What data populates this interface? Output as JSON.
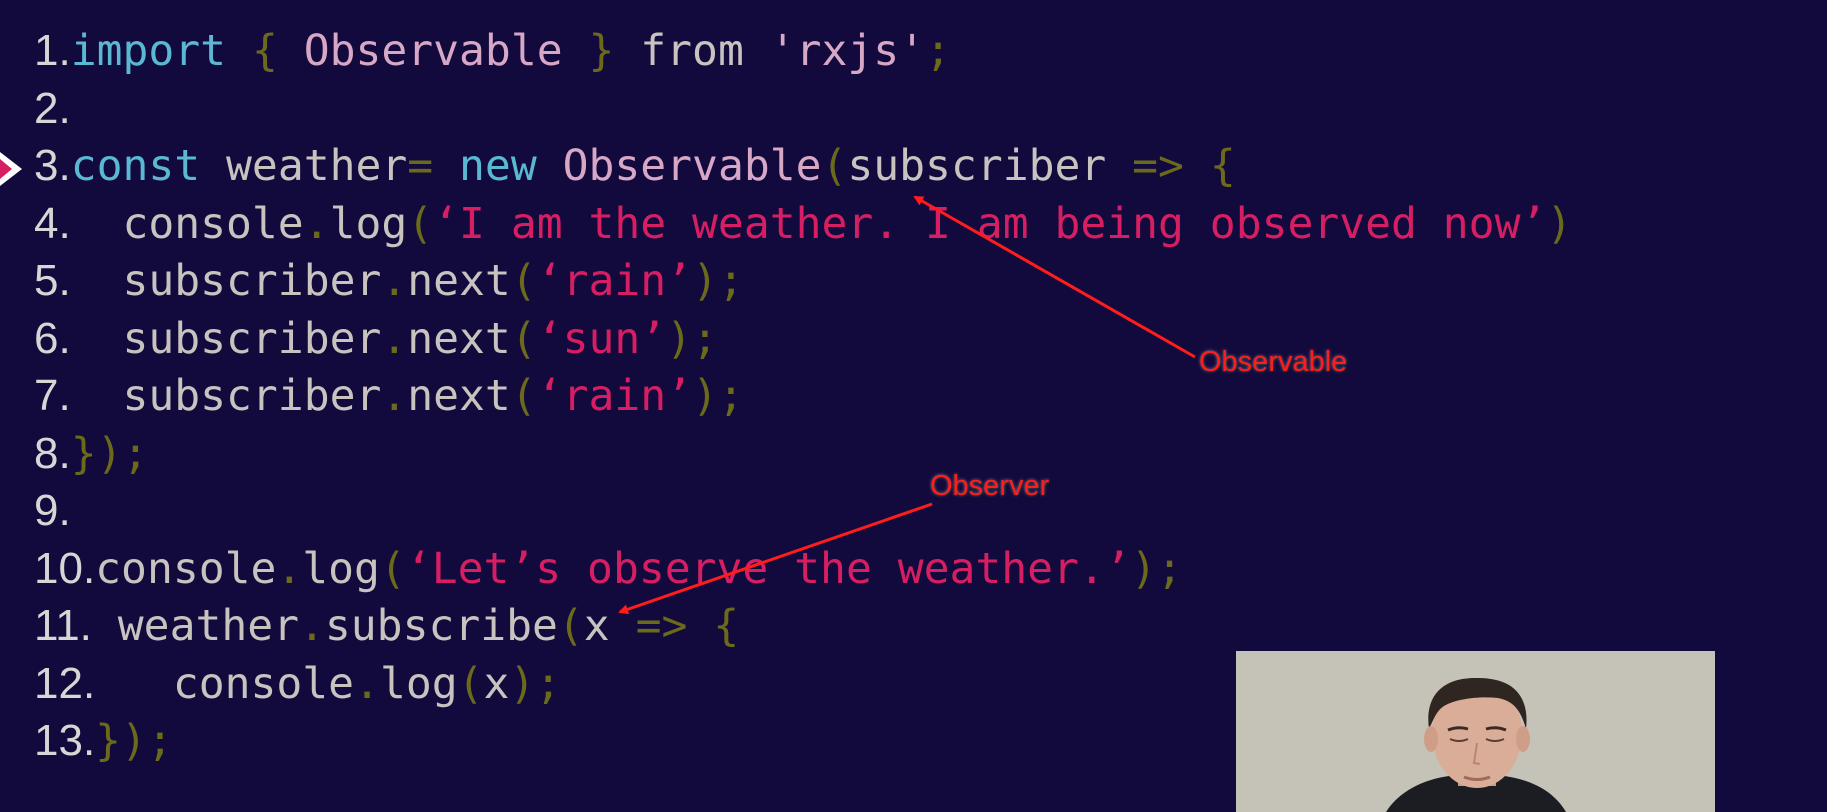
{
  "code_lines": [
    {
      "number": "1.",
      "tokens": [
        {
          "text": "import",
          "kind": "kw"
        },
        {
          "text": " ",
          "kind": "id"
        },
        {
          "text": "{",
          "kind": "pun"
        },
        {
          "text": " ",
          "kind": "id"
        },
        {
          "text": "Observable",
          "kind": "cls"
        },
        {
          "text": " ",
          "kind": "id"
        },
        {
          "text": "}",
          "kind": "pun"
        },
        {
          "text": " from ",
          "kind": "id"
        },
        {
          "text": "'rxjs'",
          "kind": "cls"
        },
        {
          "text": ";",
          "kind": "pun"
        }
      ]
    },
    {
      "number": "2.",
      "tokens": []
    },
    {
      "number": "3.",
      "tokens": [
        {
          "text": "const",
          "kind": "kw"
        },
        {
          "text": " weather",
          "kind": "id"
        },
        {
          "text": "=",
          "kind": "pun"
        },
        {
          "text": " ",
          "kind": "id"
        },
        {
          "text": "new",
          "kind": "kw"
        },
        {
          "text": " ",
          "kind": "id"
        },
        {
          "text": "Observable",
          "kind": "cls"
        },
        {
          "text": "(",
          "kind": "pun"
        },
        {
          "text": "subscriber ",
          "kind": "id"
        },
        {
          "text": "=>",
          "kind": "pun"
        },
        {
          "text": " ",
          "kind": "id"
        },
        {
          "text": "{",
          "kind": "pun"
        }
      ]
    },
    {
      "number": "4.",
      "tokens": [
        {
          "text": "  console",
          "kind": "id"
        },
        {
          "text": ".",
          "kind": "pun"
        },
        {
          "text": "log",
          "kind": "id"
        },
        {
          "text": "(",
          "kind": "pun"
        },
        {
          "text": "‘I am the weather. I am being observed now’",
          "kind": "str"
        },
        {
          "text": ")",
          "kind": "pun"
        }
      ]
    },
    {
      "number": "5.",
      "tokens": [
        {
          "text": "  subscriber",
          "kind": "id"
        },
        {
          "text": ".",
          "kind": "pun"
        },
        {
          "text": "next",
          "kind": "id"
        },
        {
          "text": "(",
          "kind": "pun"
        },
        {
          "text": "‘rain’",
          "kind": "str"
        },
        {
          "text": ");",
          "kind": "pun"
        }
      ]
    },
    {
      "number": "6.",
      "tokens": [
        {
          "text": "  subscriber",
          "kind": "id"
        },
        {
          "text": ".",
          "kind": "pun"
        },
        {
          "text": "next",
          "kind": "id"
        },
        {
          "text": "(",
          "kind": "pun"
        },
        {
          "text": "‘sun’",
          "kind": "str"
        },
        {
          "text": ");",
          "kind": "pun"
        }
      ]
    },
    {
      "number": "7.",
      "tokens": [
        {
          "text": "  subscriber",
          "kind": "id"
        },
        {
          "text": ".",
          "kind": "pun"
        },
        {
          "text": "next",
          "kind": "id"
        },
        {
          "text": "(",
          "kind": "pun"
        },
        {
          "text": "‘rain’",
          "kind": "str"
        },
        {
          "text": ");",
          "kind": "pun"
        }
      ]
    },
    {
      "number": "8.",
      "tokens": [
        {
          "text": "});",
          "kind": "pun"
        }
      ]
    },
    {
      "number": "9.",
      "tokens": []
    },
    {
      "number": "10.",
      "tokens": [
        {
          "text": "console",
          "kind": "id"
        },
        {
          "text": ".",
          "kind": "pun"
        },
        {
          "text": "log",
          "kind": "id"
        },
        {
          "text": "(",
          "kind": "pun"
        },
        {
          "text": "‘Let’s observe the weather.’",
          "kind": "str"
        },
        {
          "text": ");",
          "kind": "pun"
        }
      ]
    },
    {
      "number": "11.",
      "tokens": [
        {
          "text": " weather",
          "kind": "id"
        },
        {
          "text": ".",
          "kind": "pun"
        },
        {
          "text": "subscribe",
          "kind": "id"
        },
        {
          "text": "(",
          "kind": "pun"
        },
        {
          "text": "x ",
          "kind": "id"
        },
        {
          "text": "=>",
          "kind": "pun"
        },
        {
          "text": " ",
          "kind": "id"
        },
        {
          "text": "{",
          "kind": "pun"
        }
      ]
    },
    {
      "number": "12.",
      "tokens": [
        {
          "text": "   console",
          "kind": "id"
        },
        {
          "text": ".",
          "kind": "pun"
        },
        {
          "text": "log",
          "kind": "id"
        },
        {
          "text": "(",
          "kind": "pun"
        },
        {
          "text": "x",
          "kind": "id"
        },
        {
          "text": ");",
          "kind": "pun"
        }
      ]
    },
    {
      "number": "13.",
      "tokens": [
        {
          "text": "});",
          "kind": "pun"
        }
      ]
    }
  ],
  "annotations": {
    "observable": "Observable",
    "observer": "Observer"
  },
  "colors": {
    "background": "#120a3d",
    "keyword": "#5ab8d2",
    "class_name": "#d7a7c6",
    "string": "#d81e63",
    "punctuation": "#6b6a1b",
    "identifier": "#c9c3bf",
    "line_number": "#d8d6d4",
    "annotation": "#ff1c1c",
    "current_line_marker": "#d81e63"
  },
  "current_line_marker": {
    "line": "3.",
    "icon": "play-triangle-icon"
  },
  "webcam": {
    "icon": "presenter-webcam-video"
  }
}
